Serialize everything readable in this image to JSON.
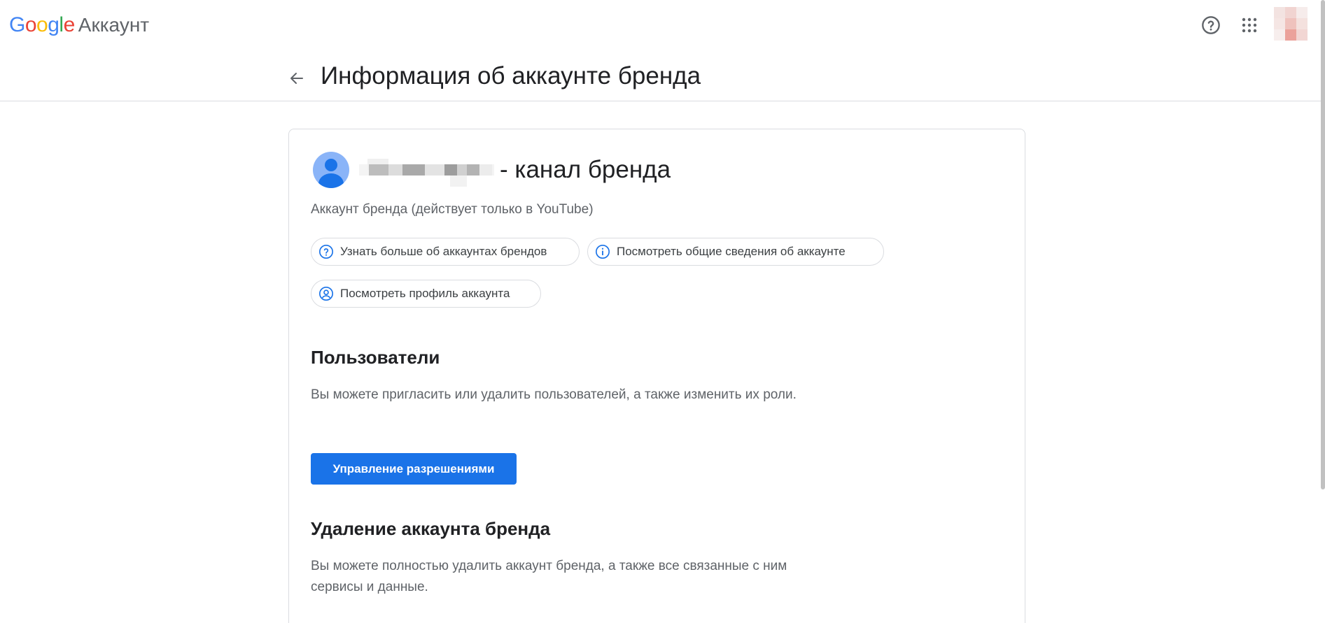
{
  "topbar": {
    "logo_google_letters": [
      "G",
      "o",
      "o",
      "g",
      "l",
      "e"
    ],
    "logo_product": "Аккаунт",
    "help_icon": "help-circle-icon",
    "apps_icon": "apps-grid-icon",
    "avatar_icon": "user-avatar-pixelated"
  },
  "header": {
    "back_icon": "arrow-back-icon",
    "title": "Информация об аккаунте бренда"
  },
  "card": {
    "brand_name_suffix": "- канал бренда",
    "account_type": "Аккаунт бренда (действует только в YouTube)",
    "chips": [
      {
        "icon": "help-circle-icon",
        "label": "Узнать больше об аккаунтах брендов"
      },
      {
        "icon": "info-icon",
        "label": "Посмотреть общие сведения об аккаунте"
      },
      {
        "icon": "account-circle-icon",
        "label": "Посмотреть профиль аккаунта"
      }
    ],
    "users": {
      "title": "Пользователи",
      "description": "Вы можете пригласить или удалить пользователей, а также изменить их роли.",
      "button_label": "Управление разрешениями"
    },
    "delete": {
      "title": "Удаление аккаунта бренда",
      "description": "Вы можете полностью удалить аккаунт бренда, а также все связанные с ним сервисы и данные."
    }
  },
  "colors": {
    "primary": "#1a73e8",
    "text_primary": "#202124",
    "text_secondary": "#5f6368",
    "border": "#dadce0"
  }
}
